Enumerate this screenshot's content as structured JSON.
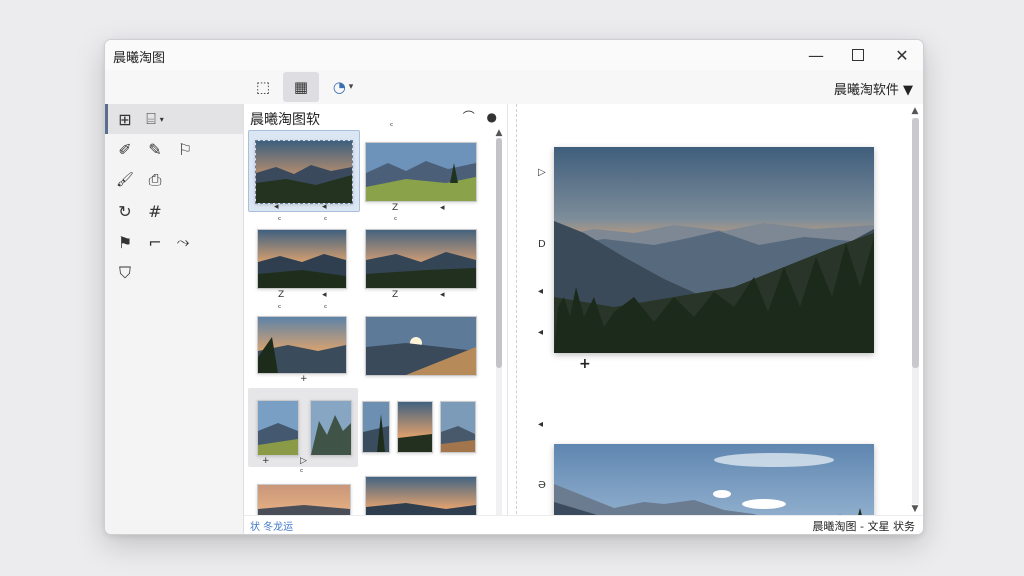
{
  "window": {
    "title": "晨曦淘图",
    "minimize_glyph": "—",
    "close_glyph": "✕"
  },
  "toolbar": {
    "select_icon": "⬚",
    "grid_icon": "▦",
    "palette_icon": "◔",
    "caret": "▾",
    "right_label": "晨曦淘软件 ▼"
  },
  "tools": [
    {
      "name": "grid-tool-icon",
      "glyph": "⊞"
    },
    {
      "name": "shape-tool-icon",
      "glyph": "⌸"
    },
    {
      "name": "pencil-icon",
      "glyph": "✐"
    },
    {
      "name": "pen-icon",
      "glyph": "✎"
    },
    {
      "name": "flag-icon",
      "glyph": "⚐"
    },
    {
      "name": "brush-icon",
      "glyph": "🖌"
    },
    {
      "name": "camera-icon",
      "glyph": "⎙"
    },
    {
      "name": "rotate-icon",
      "glyph": "↻"
    },
    {
      "name": "hash-icon",
      "glyph": "#"
    },
    {
      "name": "banner-icon",
      "glyph": "⚑"
    },
    {
      "name": "crop-icon",
      "glyph": "⌐"
    },
    {
      "name": "route-icon",
      "glyph": "⤳"
    },
    {
      "name": "shield-icon",
      "glyph": "⛉"
    }
  ],
  "thumbnail_panel": {
    "header": "晨曦淘图软",
    "header_icons": "⌒ ●",
    "scroll_up": "▲",
    "scroll_down": "▼"
  },
  "marks": {
    "z": "Z",
    "arrow": "◂",
    "c": "ᶜ",
    "plus": "+",
    "tri": "▷",
    "d": "D",
    "three": "Ə"
  },
  "canvas": {
    "add_glyph": "+",
    "scroll_up": "▲",
    "scroll_down": "▼"
  },
  "statusbar": {
    "left": "状 冬龙运",
    "right": "晨曦淘图 - 文星 状务"
  }
}
